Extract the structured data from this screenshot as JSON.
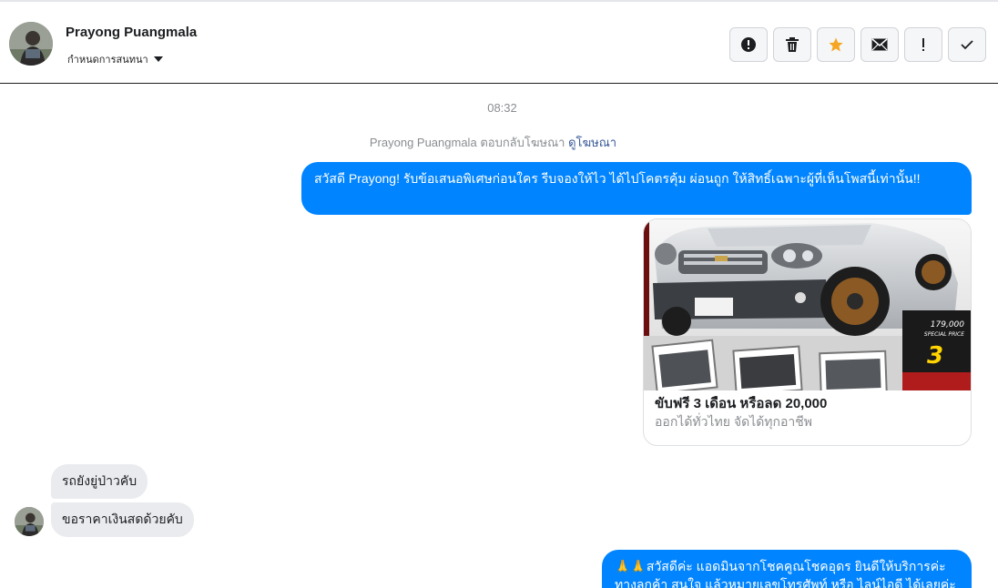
{
  "header": {
    "contact_name": "Prayong Puangmala",
    "settings_label": "กำหนดการสนทนา",
    "actions": [
      {
        "icon": "alert-circle-icon"
      },
      {
        "icon": "trash-icon"
      },
      {
        "icon": "star-icon",
        "color": "#f5a623"
      },
      {
        "icon": "envelope-icon"
      },
      {
        "icon": "exclamation-icon"
      },
      {
        "icon": "check-icon"
      }
    ]
  },
  "conversation": {
    "timestamp": "08:32",
    "reply_note_name": "Prayong Puangmala",
    "reply_note_text": "ตอบกลับโฆษณา",
    "reply_note_link": "ดูโฆษณา"
  },
  "messages": {
    "out_1": "สวัสดี Prayong! รับข้อเสนอพิเศษก่อนใคร รีบจองให้ไว ได้ไปโคตรคุ้ม ผ่อนถูก ให้สิทธิ์เฉพาะผู้ที่เห็นโพสนี้เท่านั้น!!",
    "ad_title": "ขับฟรี 3 เดือน หรือลด 20,000",
    "ad_subtitle": "ออกได้ทั่วไทย จัดได้ทุกอาชีพ",
    "ad_price": "179,000",
    "ad_special": "SPECIAL PRICE",
    "ad_months": "3",
    "in_1": "รถยังยู่ป่าวคับ",
    "in_2": "ขอราคาเงินสดด้วยคับ",
    "out_2": "🙏🙏สวัสดีค่ะ แอดมินจากโชคคูณโชคอุดร ยินดีให้บริการค่ะ ทางลูกค้า สนใจ แล้วหมายเลขโทรศัพท์ หรือ ไลน์ไอดี ได้เลยค่ะ"
  },
  "colors": {
    "accent": "#0084ff",
    "incoming_bubble": "#e9ebee",
    "star": "#f5a623"
  }
}
